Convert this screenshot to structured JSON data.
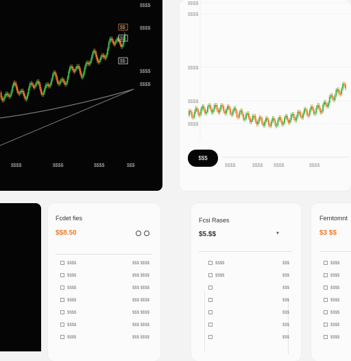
{
  "dark_chart": {
    "y_ticks": [
      "$$$$",
      "$$$$",
      "$$$$",
      "$$$$"
    ],
    "x_ticks": [
      "$$$$",
      "$$$$",
      "$$$$",
      "$$$"
    ],
    "callouts": [
      "$$",
      "$$",
      "$$"
    ],
    "colors": {
      "up": "#3fb849",
      "down": "#f07a2a",
      "trend": "#7a7a7a",
      "bg": "#050505"
    }
  },
  "light_chart": {
    "y_ticks": [
      "$$$$",
      "$$$$",
      "$$$$",
      "$$$$",
      "$$$$"
    ],
    "x_ticks": [
      "$$$$",
      "$$$$",
      "$$$$",
      "$$$$"
    ],
    "pill_label": "$$$",
    "colors": {
      "up": "#3fb849",
      "down": "#f07a2a",
      "grid": "#eaeaea"
    }
  },
  "cards": [
    {
      "title": "Fcdet fies",
      "price": "$$8.50",
      "rows": [
        [
          "$$$$",
          "$$$ $$$$"
        ],
        [
          "$$$$",
          "$$$ $$$$"
        ],
        [
          "$$$$",
          "$$$ $$$$"
        ],
        [
          "$$$$",
          "$$$ $$$$"
        ],
        [
          "$$$$",
          "$$$ $$$$"
        ],
        [
          "$$$$",
          "$$$ $$$$"
        ],
        [
          "$$$$",
          "$$$ $$$$"
        ]
      ]
    },
    {
      "title": "Fcsi Rases",
      "price": "$5.$$",
      "rows": [
        [
          "$$$$",
          "$$$"
        ],
        [
          "$$$$",
          "$$$"
        ],
        [
          "",
          "$$$"
        ],
        [
          "",
          "$$$"
        ],
        [
          "",
          "$$$"
        ],
        [
          "",
          "$$$"
        ],
        [
          "",
          "$$$"
        ]
      ]
    },
    {
      "title": "Ferntomnt",
      "price": "$3 $$",
      "rows": [
        [
          "$$$$"
        ],
        [
          "$$$$"
        ],
        [
          "$$$$"
        ],
        [
          "$$$$"
        ],
        [
          "$$$$"
        ],
        [
          "$$$$"
        ],
        [
          "$$$$"
        ]
      ]
    }
  ]
}
